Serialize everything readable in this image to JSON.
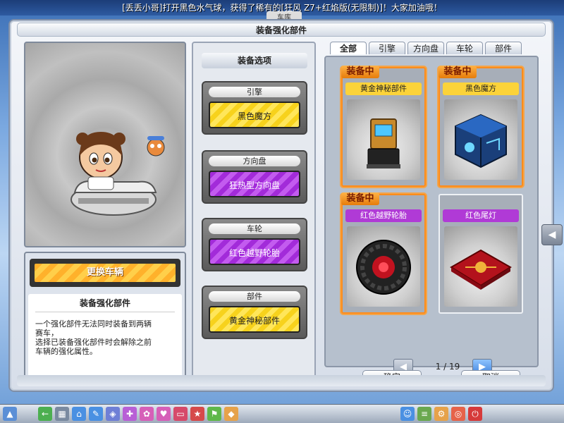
{
  "broadcast": "[丢丢小哥]打开黑色水气球，获得了稀有的[狂风 Z7+红焰版(无限制)]！大家加油哦！",
  "bg_tab": "车库",
  "window": {
    "title": "装备强化部件"
  },
  "left": {
    "change_button": "更换车辆",
    "info_title": "装备强化部件",
    "info_lines": [
      "一个强化部件无法同时装备到两辆",
      "赛车，",
      "选择已装备强化部件时会解除之前",
      "车辆的强化属性。"
    ]
  },
  "options": {
    "header": "装备选项",
    "slots": [
      {
        "label": "引擎",
        "value": "黑色魔方",
        "color": "#f7d21c"
      },
      {
        "label": "方向盘",
        "value": "狂热型方向盘",
        "color": "#a22bd9"
      },
      {
        "label": "车轮",
        "value": "红色越野轮胎",
        "color": "#a22bd9"
      },
      {
        "label": "部件",
        "value": "黄金神秘部件",
        "color": "#f7d21c"
      }
    ]
  },
  "tabs": [
    "全部",
    "引擎",
    "方向盘",
    "车轮",
    "部件"
  ],
  "cards": [
    {
      "name": "黄金神秘部件",
      "badge": "装备中",
      "icon": "golden-mystery-part-icon"
    },
    {
      "name": "黑色魔方",
      "badge": "装备中",
      "icon": "black-cube-icon"
    },
    {
      "name": "红色越野轮胎",
      "badge": "装备中",
      "icon": "red-tire-icon"
    },
    {
      "name": "红色尾灯",
      "badge": "",
      "icon": "red-taillight-icon"
    }
  ],
  "pager": {
    "current": "1",
    "separator": "/",
    "total": "19",
    "prev": "◀",
    "next": "▶"
  },
  "buttons": {
    "ok": "确定",
    "cancel": "取消"
  },
  "side_arrow": "◀",
  "colors": {
    "accent_orange": "#ff8c1a",
    "purple": "#b03ad6",
    "yellow": "#fbd33a"
  }
}
